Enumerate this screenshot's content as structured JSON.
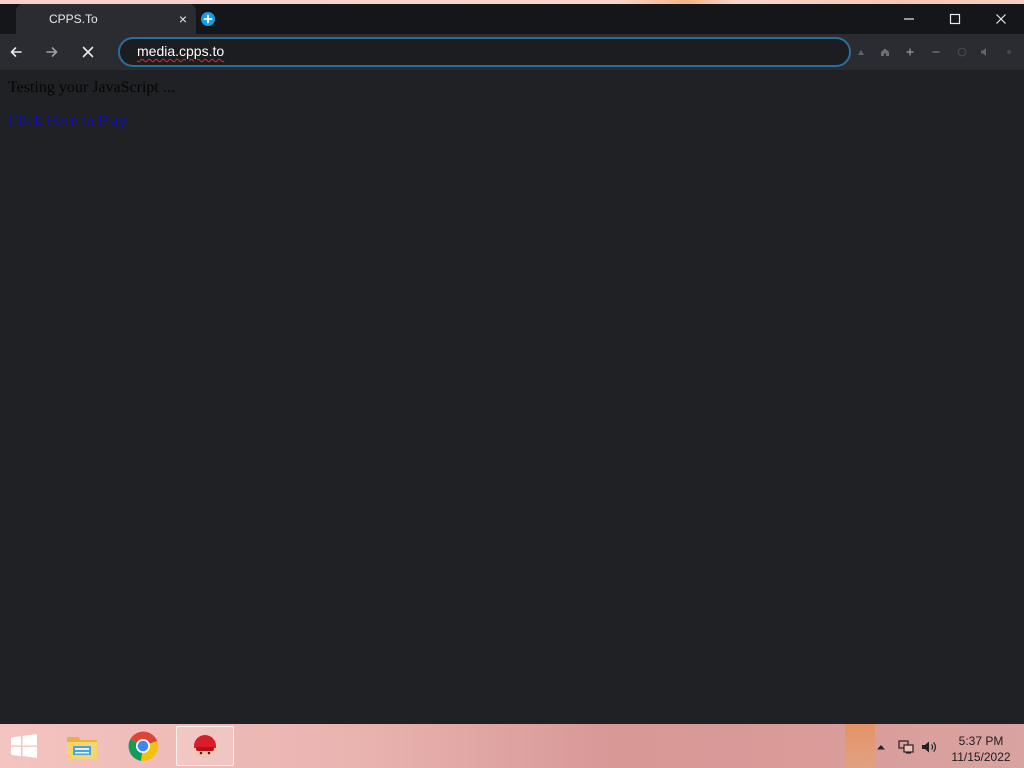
{
  "browser": {
    "tab": {
      "title": "CPPS.To",
      "close_glyph": "×"
    },
    "new_tab_icon": "plus-circle-icon",
    "window_controls": [
      "minimize-icon",
      "maximize-icon",
      "close-icon"
    ],
    "nav": {
      "back_icon": "back-arrow-icon",
      "forward_icon": "forward-arrow-icon",
      "stop_icon": "stop-icon"
    },
    "omnibox": {
      "url": "media.cpps.to"
    },
    "toolbar_icons": [
      "extensions-icon",
      "home-icon",
      "zoom-in-icon",
      "zoom-out-icon",
      "record-icon",
      "audio-icon",
      "menu-icon"
    ]
  },
  "page": {
    "status_text": "Testing your JavaScript ...",
    "link_text": "Click Here to Play"
  },
  "taskbar": {
    "start_icon": "windows-start-icon",
    "pinned": [
      {
        "name": "file-explorer-icon"
      },
      {
        "name": "chrome-icon"
      },
      {
        "name": "cpps-app-icon",
        "active": true
      }
    ],
    "tray_icons": [
      "show-hidden-icons-icon",
      "network-icon",
      "volume-icon"
    ],
    "clock": {
      "time": "5:37 PM",
      "date": "11/15/2022"
    }
  },
  "colors": {
    "browser_bg": "#202124",
    "titlebar_bg": "#151619",
    "toolbar_bg": "#2b2c31",
    "omnibox_border": "#2a6f9a",
    "link": "#0c0ccf",
    "new_tab_accent": "#1a9be6"
  }
}
